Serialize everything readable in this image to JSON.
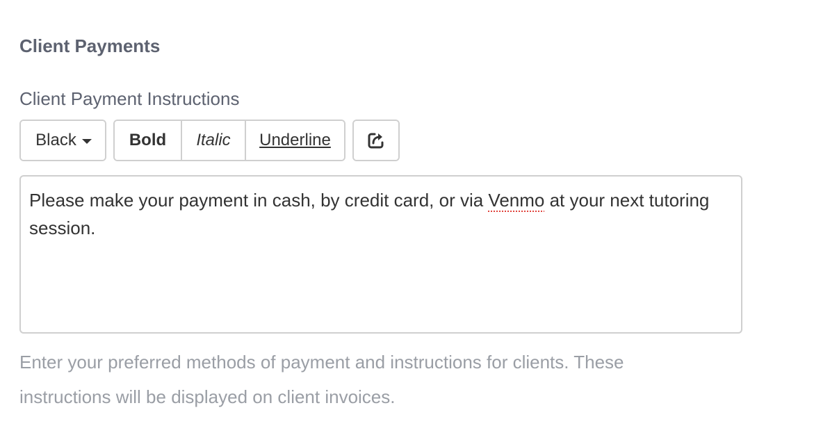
{
  "section": {
    "title": "Client Payments"
  },
  "field": {
    "label": "Client Payment Instructions"
  },
  "toolbar": {
    "color_label": "Black",
    "bold_label": "Bold",
    "italic_label": "Italic",
    "underline_label": "Underline",
    "action_icon": "share-arrow-icon"
  },
  "editor": {
    "text_before": "Please make your payment in cash, by credit card, or via ",
    "misspelled_word": "Venmo",
    "text_after": " at your next tutoring session."
  },
  "help": {
    "text": "Enter your preferred methods of payment and instructions for clients. These instructions will be displayed on client invoices."
  },
  "colors": {
    "label_text": "#5d6270",
    "help_text": "#9a9ea5",
    "border": "#cfcfcf",
    "spellcheck": "#e0413a"
  }
}
